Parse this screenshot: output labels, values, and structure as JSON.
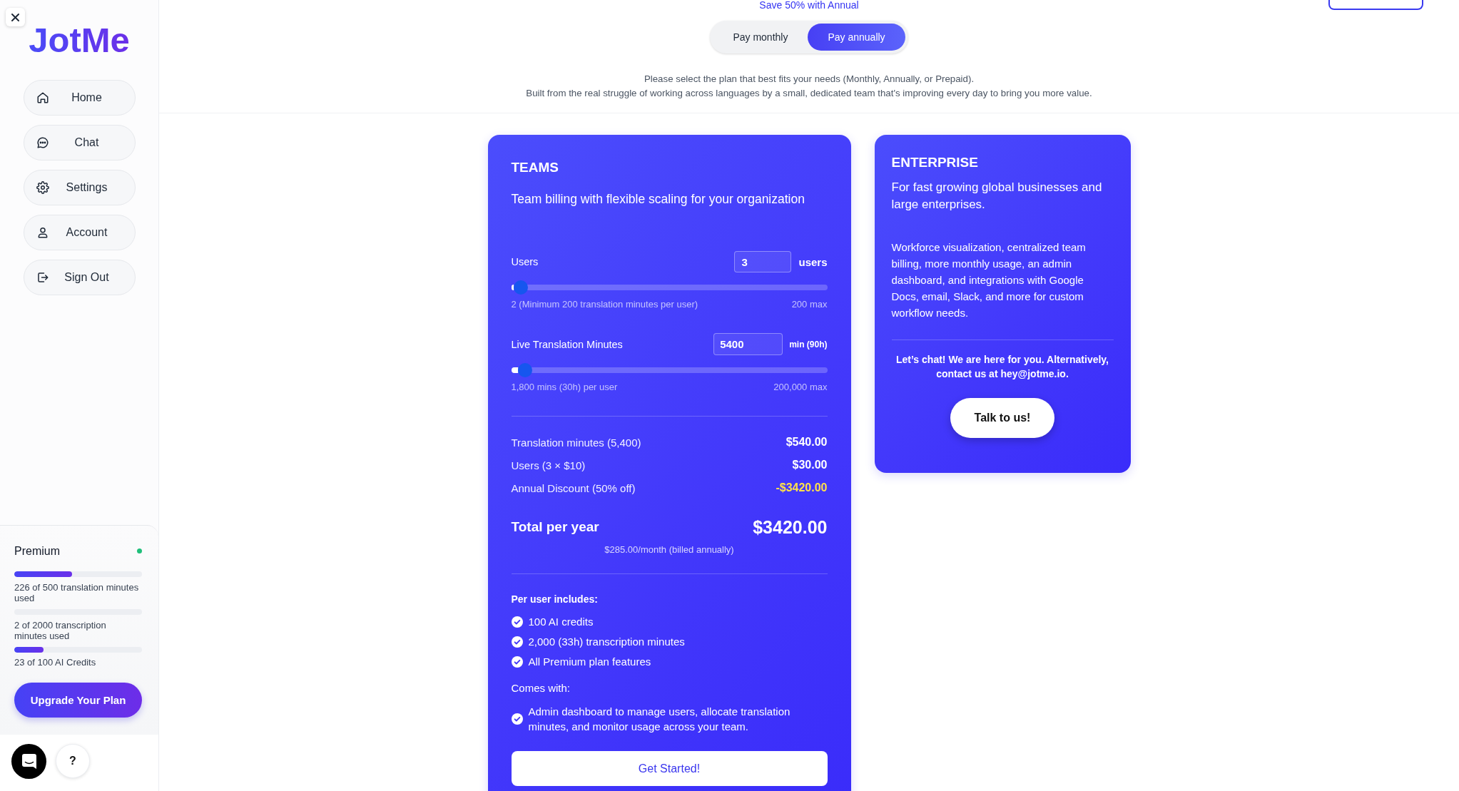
{
  "sidebar": {
    "logo": "JotMe",
    "nav_items": [
      {
        "kind": "home",
        "label": "Home"
      },
      {
        "kind": "chat",
        "label": "Chat"
      },
      {
        "kind": "settings",
        "label": "Settings"
      },
      {
        "kind": "account",
        "label": "Account"
      },
      {
        "kind": "sign_out",
        "label": "Sign Out"
      }
    ],
    "plan": {
      "name": "Premium",
      "active": true,
      "usage": [
        {
          "text": "226 of 500 translation minutes used",
          "level": 0.45
        },
        {
          "text": "2 of 2000 transcription minutes used"
        },
        {
          "text": "23 of 100 AI Credits",
          "level": 0.23
        }
      ],
      "upgrade_button": "Upgrade Your Plan"
    },
    "help_button": "?"
  },
  "pricing_header": {
    "promo": "Save 50% with Annual",
    "billing_options": [
      {
        "label": "Pay monthly",
        "selected": false
      },
      {
        "label": "Pay annually",
        "selected": true
      }
    ],
    "description": [
      "Please select the plan that best fits your needs (Monthly, Annually, or Prepaid).",
      "Built from the real struggle of working across languages by a small, dedicated team that's improving every day to bring you more value."
    ]
  },
  "teams_plan": {
    "title": "TEAMS",
    "subtitle": "Team billing with flexible scaling for your organization",
    "sliders": [
      {
        "kind": "count",
        "label": "Users",
        "value": "3",
        "unit": "users",
        "level": 0.03,
        "min_note": "2 (Minimum 200 translation minutes per user)",
        "max_note": "200 max"
      },
      {
        "kind": "duration",
        "label": "Live Translation Minutes",
        "value": "5400",
        "unit": "min (90h)",
        "level": 0.045,
        "min_note": "1,800 mins (30h) per user",
        "max_note": "200,000 max"
      }
    ],
    "line_items": [
      {
        "kind": "charge",
        "label": "Translation minutes (5,400)",
        "amount": "$540.00"
      },
      {
        "kind": "charge",
        "label": "Users (3 × $10)",
        "amount": "$30.00"
      },
      {
        "kind": "discount",
        "label": "Annual Discount (50% off)",
        "amount": "-$3420.00"
      }
    ],
    "total": {
      "label": "Total per year",
      "amount": "$3420.00",
      "note": "$285.00/month (billed annually)"
    },
    "includes_heading": "Per user includes:",
    "includes": [
      "100 AI credits",
      "2,000 (33h) transcription minutes",
      "All Premium plan features"
    ],
    "comes_with_heading": "Comes with:",
    "comes_with": [
      "Admin dashboard to manage users, allocate translation minutes, and monitor usage across your team."
    ],
    "button": "Get Started!"
  },
  "enterprise_plan": {
    "title": "ENTERPRISE",
    "subtitle": "For fast growing global businesses and large enterprises.",
    "description": "Workforce visualization, centralized team billing, more monthly usage, an admin dashboard, and integrations with Google Docs, email, Slack, and more for custom workflow needs.",
    "contact": "Let’s chat! We are here for you. Alternatively, contact us at hey@jotme.io.",
    "button": "Talk to us!"
  }
}
